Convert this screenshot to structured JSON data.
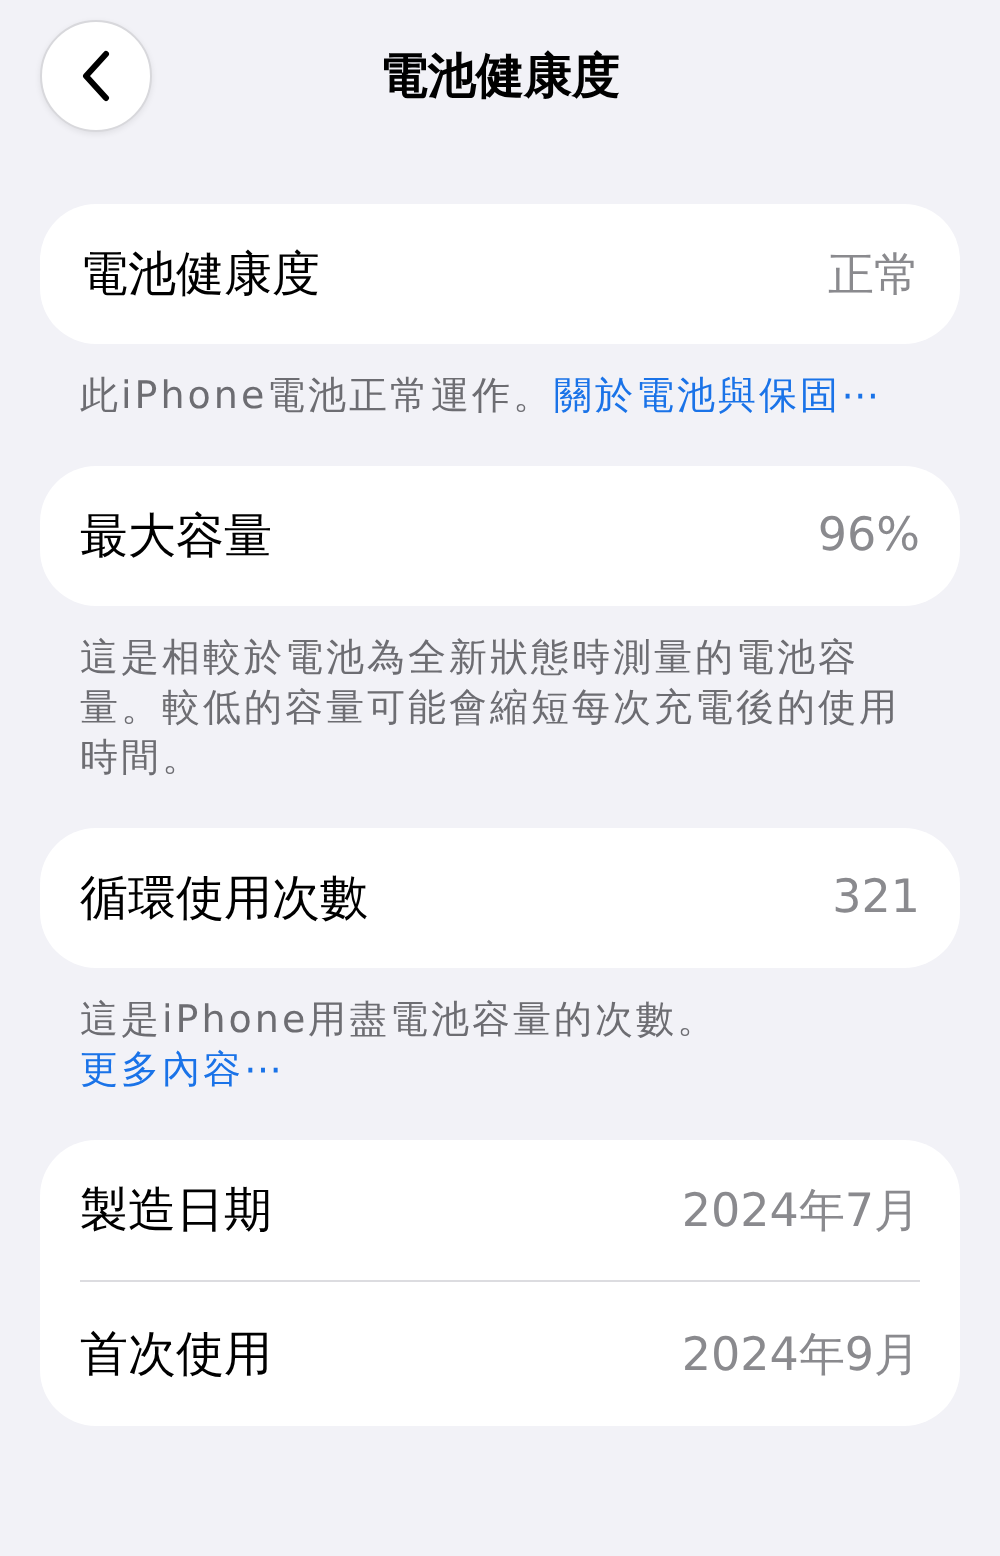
{
  "header": {
    "title": "電池健康度"
  },
  "sections": [
    {
      "rows": [
        {
          "label": "電池健康度",
          "value": "正常"
        }
      ],
      "footer": {
        "text": "此iPhone電池正常運作。",
        "link": "關於電池與保固⋯"
      }
    },
    {
      "rows": [
        {
          "label": "最大容量",
          "value": "96%"
        }
      ],
      "footer": {
        "text": "這是相較於電池為全新狀態時測量的電池容量。較低的容量可能會縮短每次充電後的使用時間。"
      }
    },
    {
      "rows": [
        {
          "label": "循環使用次數",
          "value": "321"
        }
      ],
      "footer": {
        "text": "這是iPhone用盡電池容量的次數。",
        "link": "更多內容⋯"
      }
    },
    {
      "rows": [
        {
          "label": "製造日期",
          "value": "2024年7月"
        },
        {
          "label": "首次使用",
          "value": "2024年9月"
        }
      ]
    }
  ]
}
